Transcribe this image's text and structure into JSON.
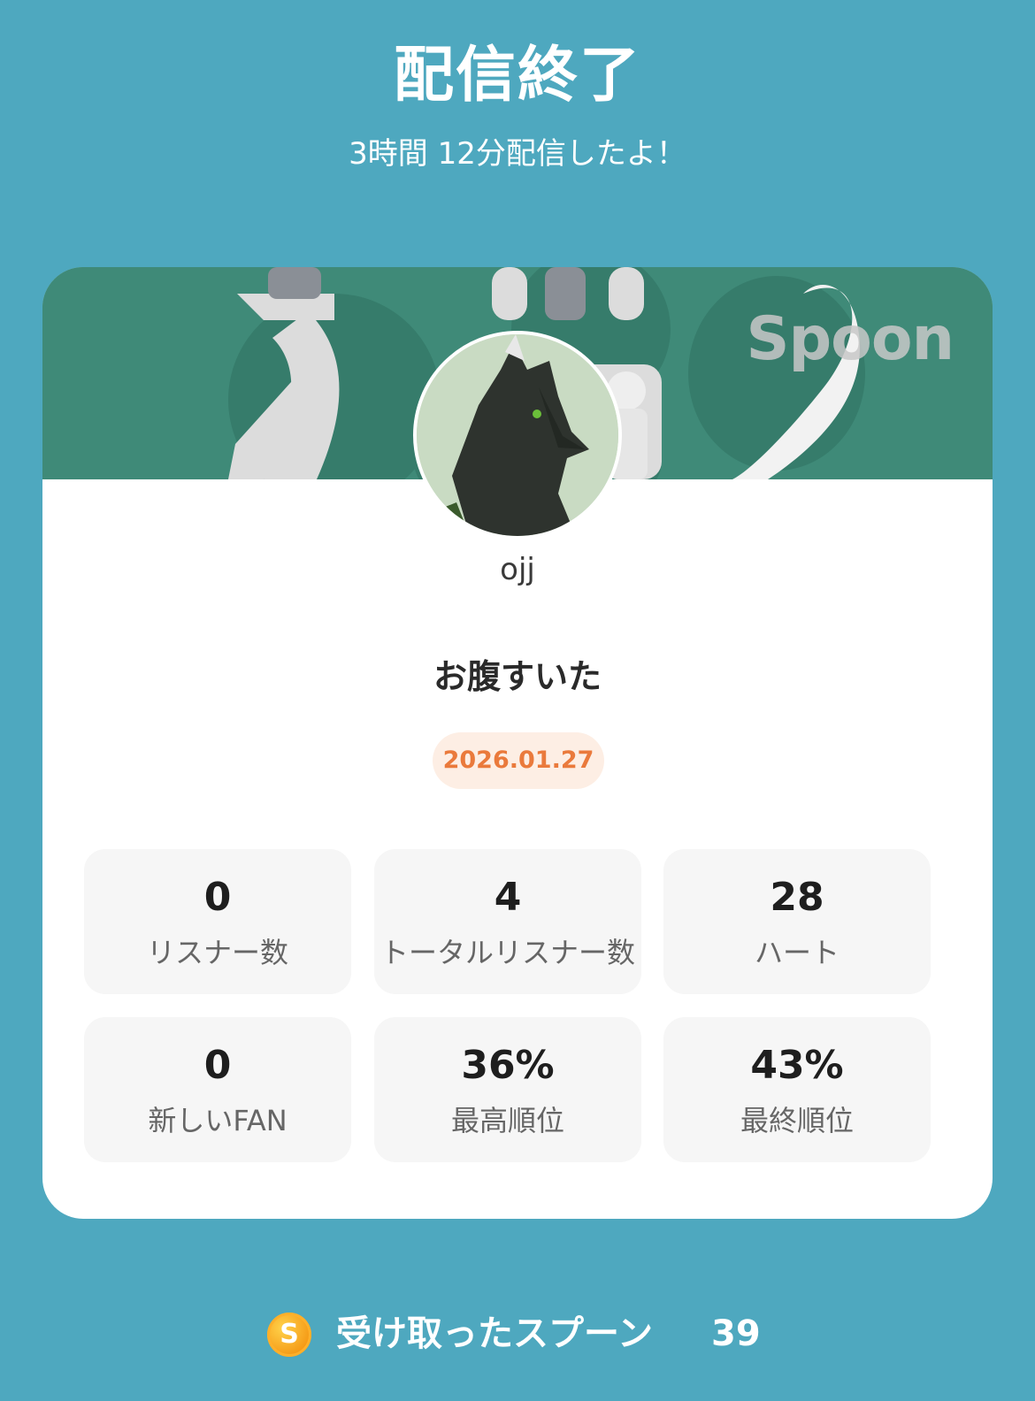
{
  "header": {
    "title": "配信終了",
    "subtitle": "3時間 12分配信したよ！"
  },
  "card": {
    "banner": {
      "logo": "Spoon",
      "background_color": "#3f8a78"
    },
    "username": "ojj",
    "live_title": "お腹すいた",
    "date": "2026.01.27",
    "stats": [
      {
        "value": "0",
        "label": "リスナー数"
      },
      {
        "value": "4",
        "label": "トータルリスナー数"
      },
      {
        "value": "28",
        "label": "ハート"
      },
      {
        "value": "0",
        "label": "新しいFAN"
      },
      {
        "value": "36%",
        "label": "最高順位"
      },
      {
        "value": "43%",
        "label": "最終順位"
      }
    ]
  },
  "footer": {
    "coin_icon": "spoon-coin-icon",
    "coin_letter": "S",
    "label": "受け取ったスプーン",
    "value": "39"
  },
  "colors": {
    "background": "#4ea8bf",
    "card": "#ffffff",
    "date_badge_bg": "#fdeee4",
    "date_badge_text": "#ea7a3c",
    "stat_tile": "#f6f6f6"
  }
}
